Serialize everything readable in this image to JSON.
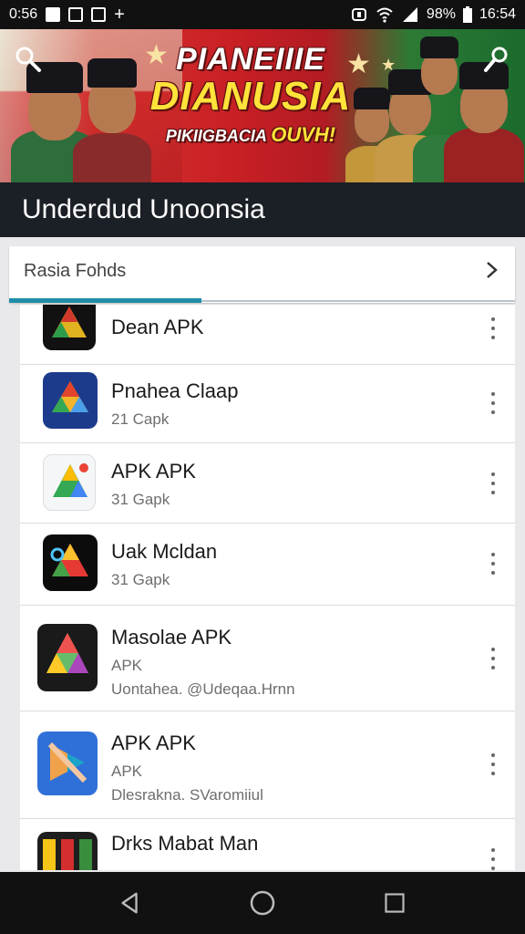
{
  "status_bar": {
    "carrier_time": "0:56",
    "battery": "98%",
    "clock": "16:54"
  },
  "banner": {
    "line1": "PIANEIIIE",
    "line2": "DIANUSIA",
    "line3_small": "PIKIIGBACIA",
    "line3_big": "OUVH!"
  },
  "header": {
    "title": "Underdud Unoonsia"
  },
  "tab": {
    "label": "Rasia Fohds"
  },
  "apps": [
    {
      "name": "Dean APK",
      "line1": "",
      "line2": ""
    },
    {
      "name": "Pnahea Claap",
      "line1": "21 Capk",
      "line2": ""
    },
    {
      "name": "APK APK",
      "line1": "31 Gapk",
      "line2": ""
    },
    {
      "name": "Uak Mcldan",
      "line1": "31 Gapk",
      "line2": ""
    },
    {
      "name": "Masolae APK",
      "line1": "APK",
      "line2": "Uontahea. @Udeqaa.Hrnn"
    },
    {
      "name": "APK APK",
      "line1": "APK",
      "line2": "Dlesrakna. SVaromiiul"
    },
    {
      "name": "Drks Mabat Man",
      "line1": "",
      "line2": ""
    }
  ],
  "icons": {
    "status": [
      "notification-icon",
      "photo-icon",
      "gallery-icon",
      "plus-icon",
      "alarm-icon",
      "wifi-icon",
      "signal-icon",
      "battery-icon"
    ],
    "banner": [
      "search-icon",
      "magic-icon"
    ],
    "nav": [
      "back-icon",
      "home-icon",
      "recents-icon"
    ]
  },
  "colors": {
    "accent": "#1f8ea8",
    "header": "#1b1f26",
    "banner_red": "#c71f24",
    "banner_green": "#1b6b2e"
  }
}
